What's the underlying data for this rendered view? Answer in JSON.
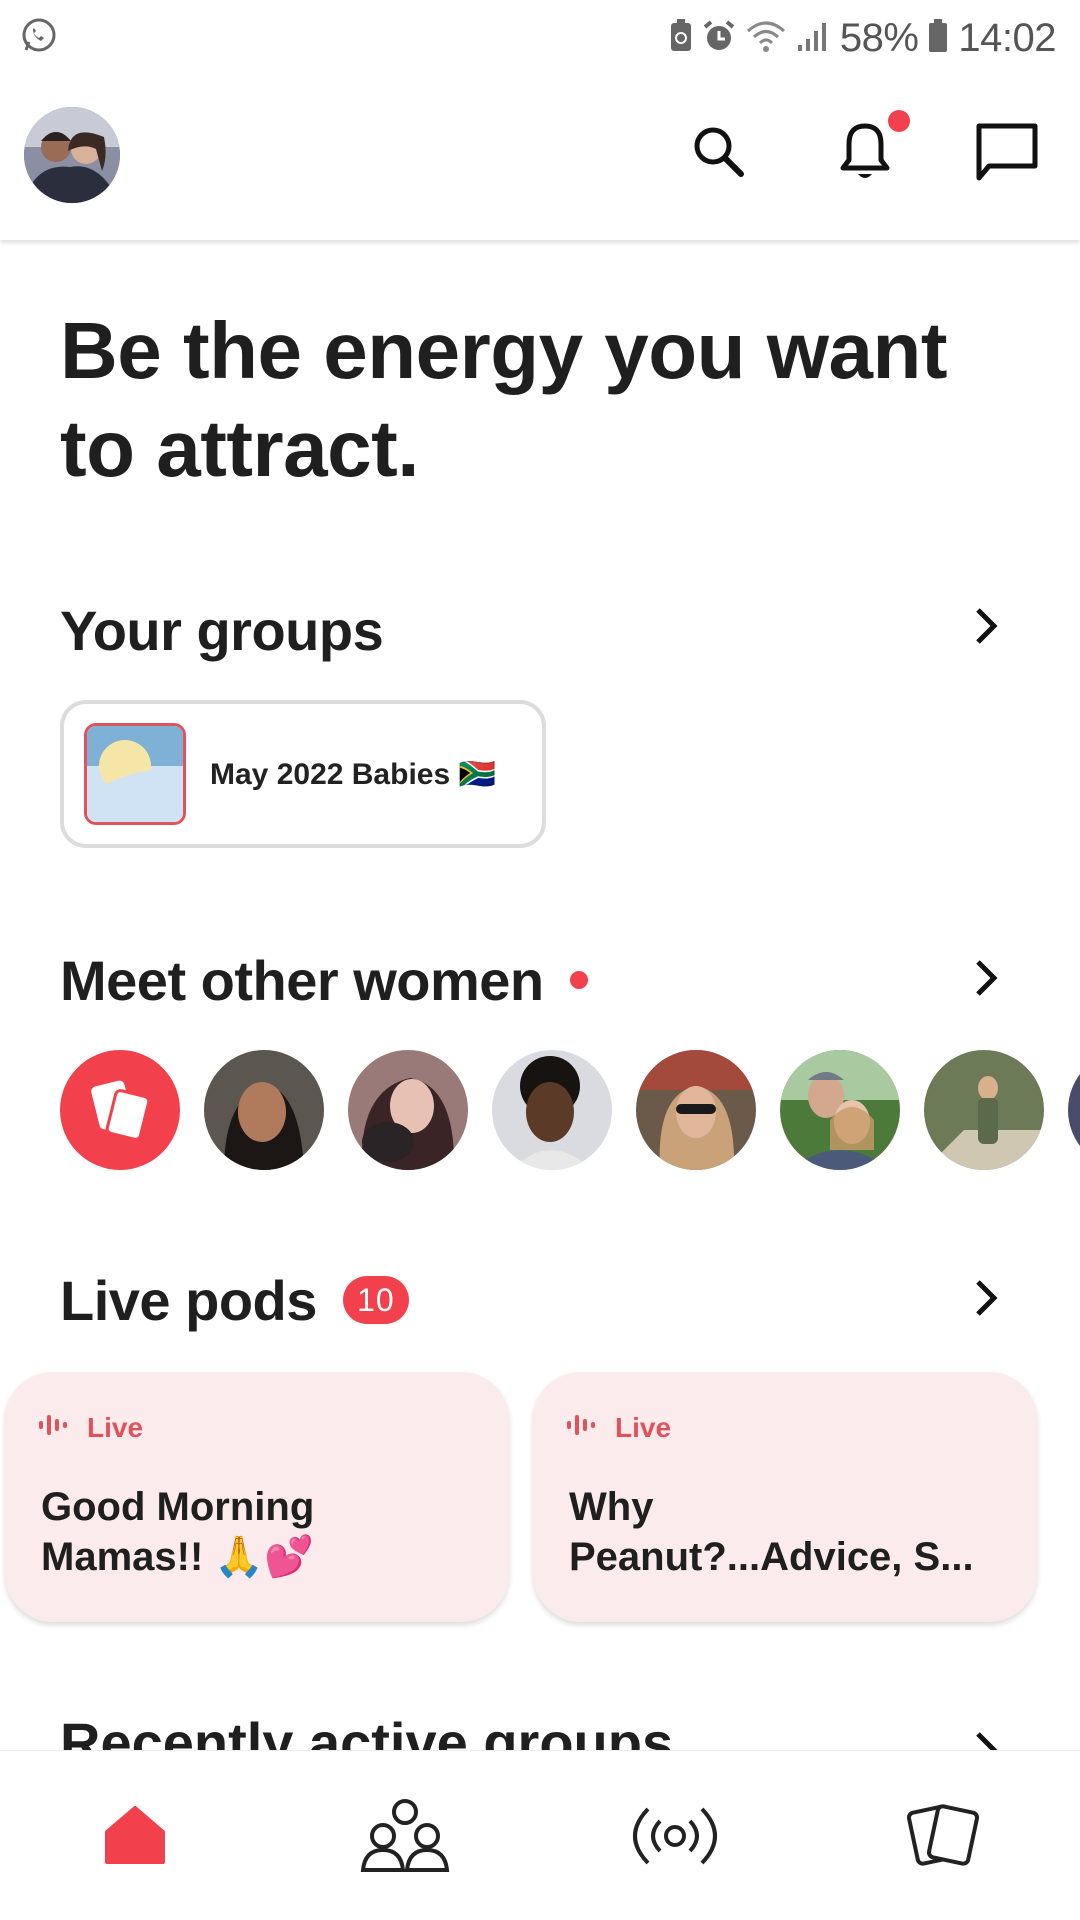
{
  "status_bar": {
    "battery_text": "58%",
    "time": "14:02",
    "icons": [
      "whatsapp-icon",
      "sync-icon",
      "alarm-icon",
      "wifi-icon",
      "signal-icon",
      "battery-icon"
    ]
  },
  "app_bar": {
    "icons": [
      "profile-avatar",
      "search-icon",
      "bell-icon",
      "chat-icon"
    ],
    "has_notification": true
  },
  "headline": {
    "line1": "Be the energy you want",
    "line2": "to attract."
  },
  "your_groups": {
    "title": "Your groups",
    "groups": [
      {
        "name": "May 2022 Babies 🇿🇦"
      }
    ]
  },
  "meet_women": {
    "title": "Meet other women",
    "avatar_count": 7
  },
  "live_pods": {
    "title": "Live pods",
    "count": "10",
    "pods": [
      {
        "status": "Live",
        "line1": "Good Morning",
        "line2": "Mamas!! 🙏💕"
      },
      {
        "status": "Live",
        "line1": "Why",
        "line2": "Peanut?...Advice, S..."
      }
    ]
  },
  "recently_active": {
    "title": "Recently active groups"
  },
  "bottom_nav": {
    "items": [
      "home-icon",
      "groups-icon",
      "live-icon",
      "cards-icon"
    ],
    "active": "home-icon"
  },
  "colors": {
    "accent": "#f2414d",
    "pod_bg": "#fcebec",
    "text": "#1f1f1f"
  }
}
